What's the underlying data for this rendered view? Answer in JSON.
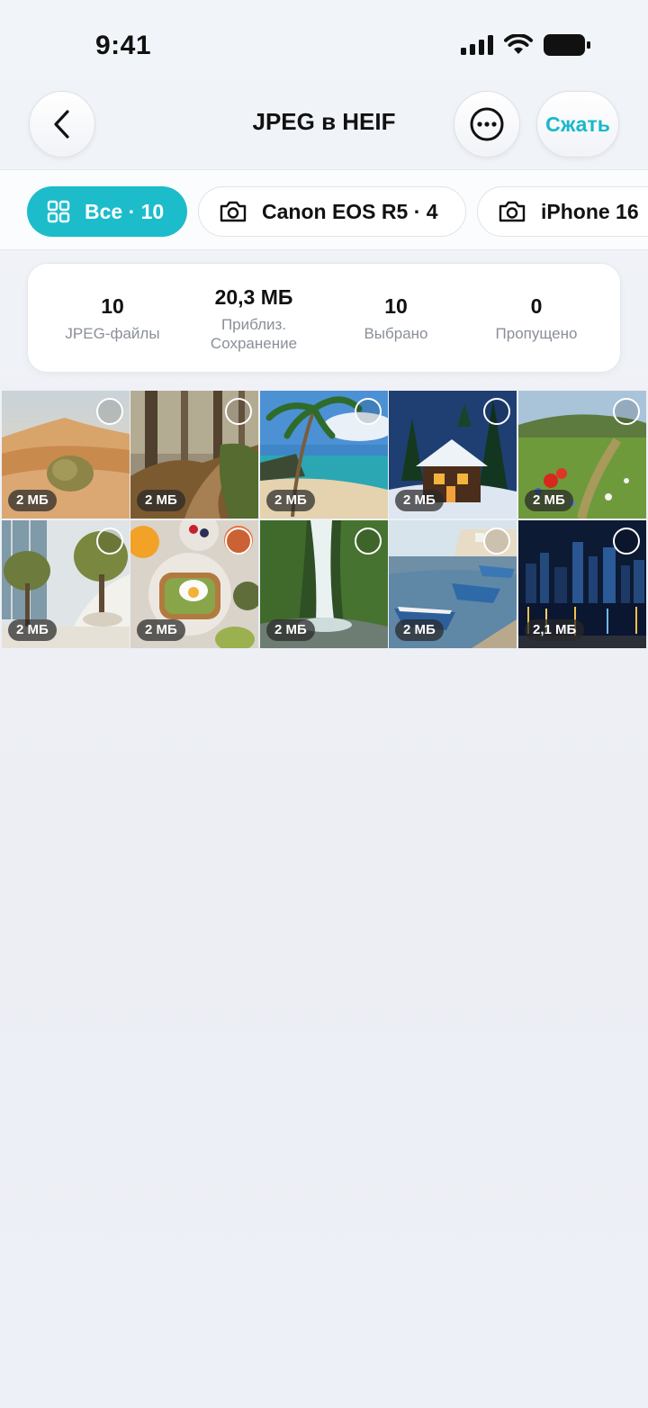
{
  "status": {
    "time": "9:41"
  },
  "nav": {
    "title": "JPEG в HEIF",
    "compress_label": "Сжать"
  },
  "filters": [
    {
      "label": "Все · 10",
      "active": true,
      "icon": "grid-icon"
    },
    {
      "label": "Canon EOS R5 · 4",
      "active": false,
      "icon": "camera-icon"
    },
    {
      "label": "iPhone 16",
      "active": false,
      "icon": "camera-icon"
    }
  ],
  "stats": [
    {
      "value": "10",
      "label": "JPEG-файлы"
    },
    {
      "value": "20,3 МБ",
      "label": "Приблиз.\nСохранение"
    },
    {
      "value": "10",
      "label": "Выбрано"
    },
    {
      "value": "0",
      "label": "Пропущено"
    }
  ],
  "photos": [
    {
      "scene": "desert",
      "size": "2 МБ",
      "selected": false
    },
    {
      "scene": "forest-path",
      "size": "2 МБ",
      "selected": false
    },
    {
      "scene": "tropical-beach",
      "size": "2 МБ",
      "selected": false
    },
    {
      "scene": "snowy-cabin",
      "size": "2 МБ",
      "selected": false
    },
    {
      "scene": "wildflower-meadow",
      "size": "2 МБ",
      "selected": false
    },
    {
      "scene": "olive-tree-atrium",
      "size": "2 МБ",
      "selected": false
    },
    {
      "scene": "avocado-toast",
      "size": "2 МБ",
      "selected": false
    },
    {
      "scene": "waterfall",
      "size": "2 МБ",
      "selected": false
    },
    {
      "scene": "harbor-boats",
      "size": "2 МБ",
      "selected": false
    },
    {
      "scene": "city-night",
      "size": "2,1 МБ",
      "selected": false
    }
  ],
  "colors": {
    "accent": "#1cbccb",
    "compress_text": "#19b8c8"
  }
}
